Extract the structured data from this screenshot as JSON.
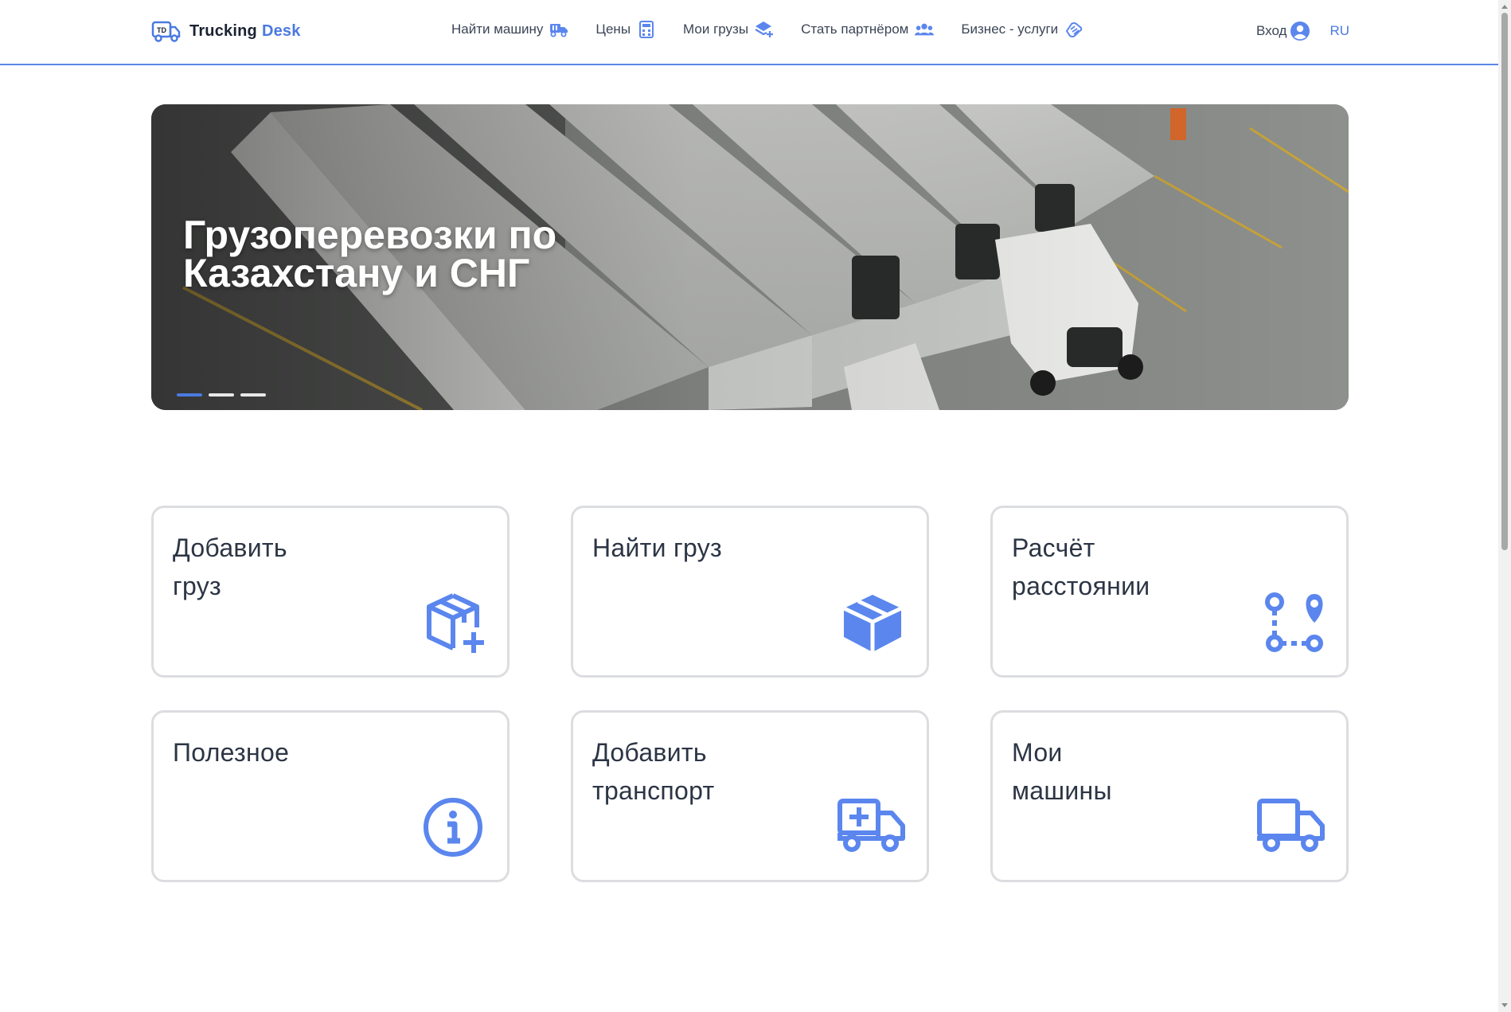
{
  "brand": {
    "name_part1": "Trucking",
    "name_part2": "Desk",
    "logo_text": "TD"
  },
  "nav": {
    "items": [
      {
        "label": "Найти машину",
        "icon": "truck-icon"
      },
      {
        "label": "Цены",
        "icon": "calculator-icon"
      },
      {
        "label": "Мои грузы",
        "icon": "layers-add-icon"
      },
      {
        "label": "Стать партнёром",
        "icon": "users-icon"
      },
      {
        "label": "Бизнес - услуги",
        "icon": "handshake-icon"
      }
    ]
  },
  "header": {
    "login_label": "Вход",
    "login_icon": "user-circle-icon",
    "language": "RU"
  },
  "hero": {
    "title_line1": "Грузоперевозки по",
    "title_line2": "Казахстану и СНГ",
    "slides_count": 3,
    "active_slide": 1
  },
  "cards": [
    {
      "title_line1": "Добавить",
      "title_line2": "груз",
      "icon": "box-add-icon"
    },
    {
      "title_line1": "Найти груз",
      "title_line2": "",
      "icon": "box-icon"
    },
    {
      "title_line1": "Расчёт",
      "title_line2": "расстоянии",
      "icon": "route-icon"
    },
    {
      "title_line1": "Полезное",
      "title_line2": "",
      "icon": "info-icon"
    },
    {
      "title_line1": "Добавить",
      "title_line2": "транспорт",
      "icon": "truck-add-icon"
    },
    {
      "title_line1": "Мои",
      "title_line2": "машины",
      "icon": "truck-icon"
    }
  ],
  "colors": {
    "accent": "#4a7ae0",
    "icon_blue": "#5b86ee",
    "border": "#dcdde0",
    "text": "#2c3545"
  }
}
